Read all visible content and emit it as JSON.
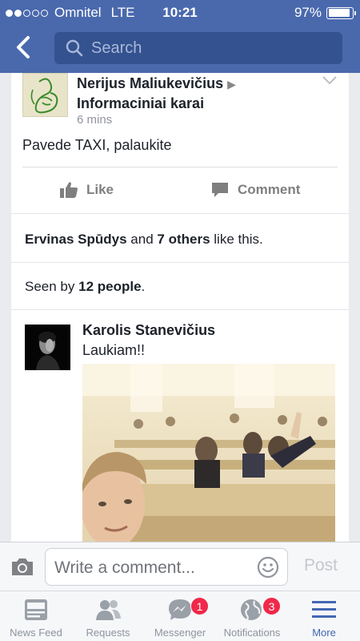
{
  "status_bar": {
    "carrier": "Omnitel",
    "network": "LTE",
    "time": "10:21",
    "battery": "97%",
    "signal_bars_filled": 2,
    "signal_bars_total": 5
  },
  "nav": {
    "back_icon": "chevron-left-icon",
    "search_placeholder": "Search"
  },
  "post": {
    "author": "Nerijus Maliukevičius",
    "target": "Informaciniai karai",
    "time_ago": "6 mins",
    "text": "Pavede TAXI, palaukite",
    "like_label": "Like",
    "comment_label": "Comment"
  },
  "likes_summary": {
    "name": "Ervinas Spūdys",
    "connector": "and",
    "others": "7 others",
    "suffix": "like this."
  },
  "seen_summary": {
    "prefix": "Seen by",
    "count": "12 people",
    "suffix": "."
  },
  "comment": {
    "author": "Karolis Stanevičius",
    "text": "Laukiam!!"
  },
  "composer": {
    "placeholder": "Write a comment...",
    "post_label": "Post"
  },
  "tabs": [
    {
      "label": "News Feed",
      "icon": "news-feed-icon",
      "badge": ""
    },
    {
      "label": "Requests",
      "icon": "friend-requests-icon",
      "badge": ""
    },
    {
      "label": "Messenger",
      "icon": "messenger-icon",
      "badge": "1"
    },
    {
      "label": "Notifications",
      "icon": "globe-icon",
      "badge": "3"
    },
    {
      "label": "More",
      "icon": "menu-icon",
      "badge": ""
    }
  ],
  "colors": {
    "brand_blue": "#4a69ad",
    "search_bg": "#34528f",
    "badge_red": "#f02849",
    "active_tab": "#4267b2"
  }
}
